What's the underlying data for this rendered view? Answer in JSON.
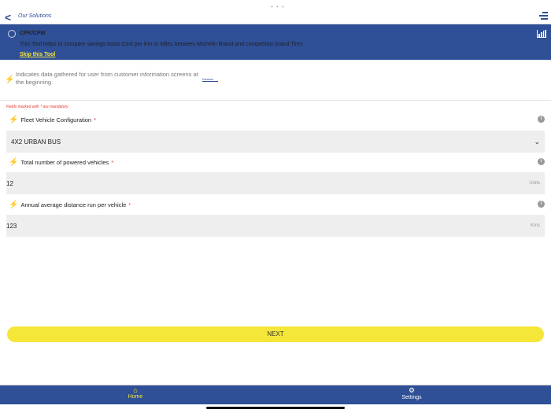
{
  "header": {
    "back_label": "Our Solutions"
  },
  "banner": {
    "title": "CPK/CPM",
    "description": "This Tool helps to compare savings basis Cost per Km or Miles between Michelin Brand and competition brand Tires",
    "skip_label": "Skip this Tool"
  },
  "notice": {
    "text": "Indicates data gathered for user from customer information screens at the beginning",
    "dismiss_label": "Dismiss"
  },
  "form": {
    "mandatory_note": "Fields marked with * are mandatory",
    "fields": [
      {
        "label": "Fleet Vehicle Configuration",
        "required": "*",
        "value": "4X2 URBAN BUS",
        "unit": ""
      },
      {
        "label": "Total number of powered vehicles",
        "required": "*",
        "value": "12",
        "unit": "Units"
      },
      {
        "label": "Annual average distance run per vehicle",
        "required": "*",
        "value": "123",
        "unit": "Kms"
      }
    ],
    "next_label": "NEXT"
  },
  "bottom_nav": {
    "items": [
      {
        "label": "Home"
      },
      {
        "label": "Settings"
      }
    ]
  },
  "colors": {
    "primary": "#2f4f96",
    "accent": "#f5e63a"
  }
}
